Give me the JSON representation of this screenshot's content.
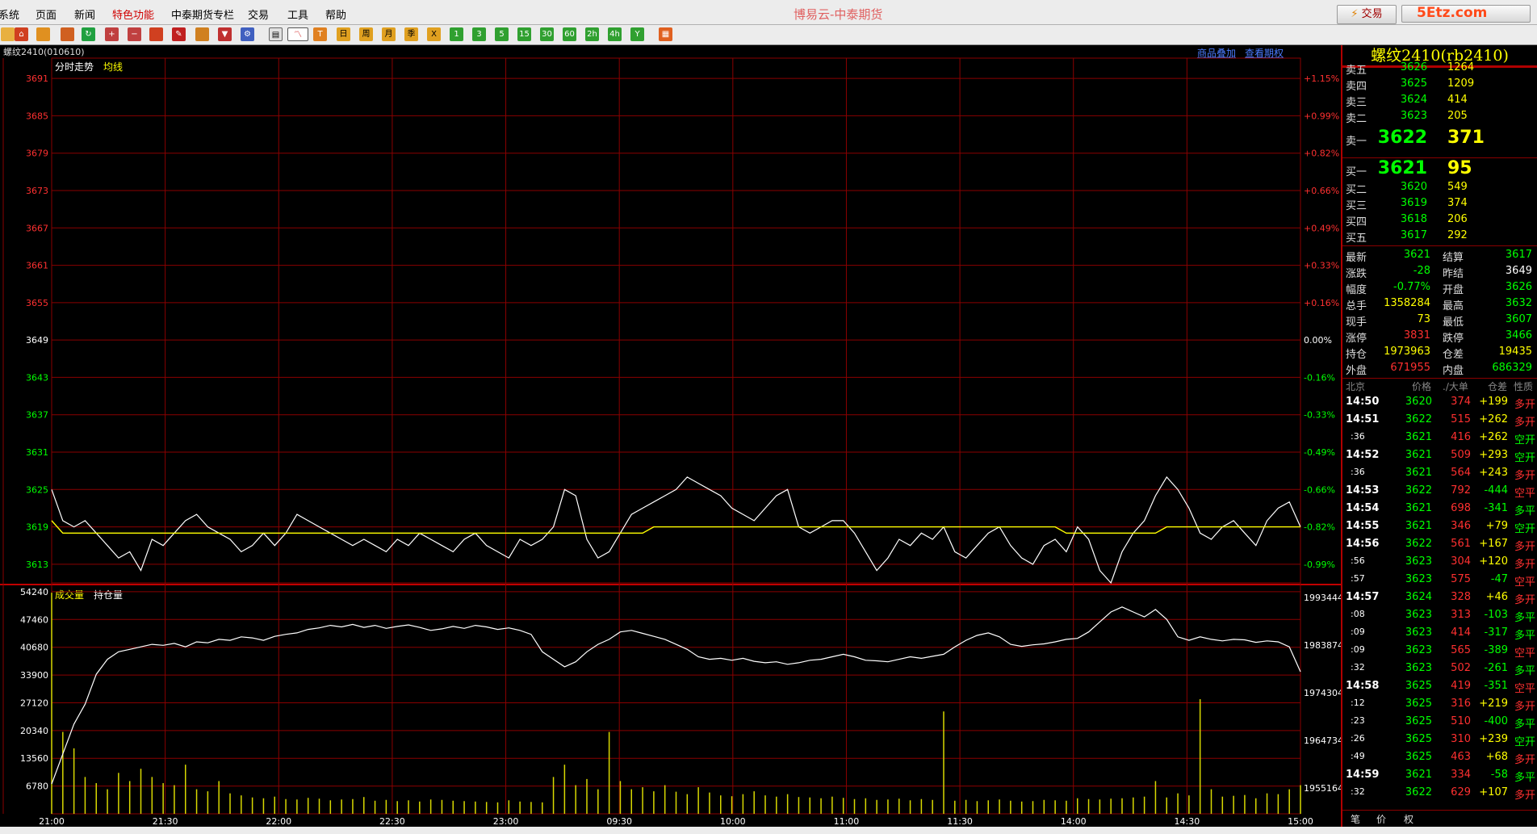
{
  "menu": [
    "系统",
    "页面",
    "新闻",
    "特色功能",
    "中泰期货专栏",
    "交易",
    "工具",
    "帮助"
  ],
  "app_title": "博易云-中泰期货",
  "trade_button": "交易",
  "watermark": "5Etz.com",
  "chart": {
    "symbol_header": "螺纹2410(010610)",
    "link_overlay": "商品叠加",
    "link_options": "查看期权",
    "legend_price": "分时走势",
    "legend_avg": "均线",
    "legend_volume": "成交量",
    "legend_oi": "持仓量",
    "price_axis": [
      "3691",
      "3685",
      "3679",
      "3673",
      "3667",
      "3661",
      "3655",
      "3649",
      "3643",
      "3637",
      "3631",
      "3625",
      "3619",
      "3613"
    ],
    "pct_axis": [
      "+1.15%",
      "+0.99%",
      "+0.82%",
      "+0.66%",
      "+0.49%",
      "+0.33%",
      "+0.16%",
      "0.00%",
      "-0.16%",
      "-0.33%",
      "-0.49%",
      "-0.66%",
      "-0.82%",
      "-0.99%"
    ],
    "volume_axis": [
      "54240",
      "47460",
      "40680",
      "33900",
      "27120",
      "20340",
      "13560",
      "6780"
    ],
    "oi_axis": [
      "1993444",
      "1983874",
      "1974304",
      "1964734",
      "1955164"
    ],
    "time_axis": [
      "21:00",
      "21:30",
      "22:00",
      "22:30",
      "23:00",
      "09:30",
      "10:00",
      "11:00",
      "11:30",
      "14:00",
      "14:30",
      "15:00"
    ]
  },
  "chart_data": {
    "type": "line",
    "title": "螺纹2410 分时走势",
    "xlabel": "",
    "ylabel": "",
    "ylim": [
      3610,
      3694
    ],
    "reference_price": 3649,
    "series": [
      {
        "name": "分时走势",
        "values": [
          3625,
          3620,
          3619,
          3620,
          3618,
          3616,
          3614,
          3615,
          3612,
          3617,
          3616,
          3618,
          3620,
          3621,
          3619,
          3618,
          3617,
          3615,
          3616,
          3618,
          3616,
          3618,
          3621,
          3620,
          3619,
          3618,
          3617,
          3616,
          3617,
          3616,
          3615,
          3617,
          3616,
          3618,
          3617,
          3616,
          3615,
          3617,
          3618,
          3616,
          3615,
          3614,
          3617,
          3616,
          3617,
          3619,
          3625,
          3624,
          3617,
          3614,
          3615,
          3618,
          3621,
          3622,
          3623,
          3624,
          3625,
          3627,
          3626,
          3625,
          3624,
          3622,
          3621,
          3620,
          3622,
          3624,
          3625,
          3619,
          3618,
          3619,
          3620,
          3620,
          3618,
          3615,
          3612,
          3614,
          3617,
          3616,
          3618,
          3617,
          3619,
          3615,
          3614,
          3616,
          3618,
          3619,
          3616,
          3614,
          3613,
          3616,
          3617,
          3615,
          3619,
          3617,
          3612,
          3610,
          3615,
          3618,
          3620,
          3624,
          3627,
          3625,
          3622,
          3618,
          3617,
          3619,
          3620,
          3618,
          3616,
          3620,
          3622,
          3623,
          3619
        ]
      },
      {
        "name": "均线",
        "values": [
          3620,
          3618,
          3618,
          3618,
          3618,
          3618,
          3618,
          3618,
          3618,
          3618,
          3618,
          3618,
          3618,
          3618,
          3618,
          3618,
          3618,
          3618,
          3618,
          3618,
          3618,
          3618,
          3618,
          3618,
          3618,
          3618,
          3618,
          3618,
          3618,
          3618,
          3618,
          3618,
          3618,
          3618,
          3618,
          3618,
          3618,
          3618,
          3618,
          3618,
          3618,
          3618,
          3618,
          3618,
          3618,
          3618,
          3618,
          3618,
          3618,
          3618,
          3618,
          3618,
          3618,
          3618,
          3619,
          3619,
          3619,
          3619,
          3619,
          3619,
          3619,
          3619,
          3619,
          3619,
          3619,
          3619,
          3619,
          3619,
          3619,
          3619,
          3619,
          3619,
          3619,
          3619,
          3619,
          3619,
          3619,
          3619,
          3619,
          3619,
          3619,
          3619,
          3619,
          3619,
          3619,
          3619,
          3619,
          3619,
          3619,
          3619,
          3619,
          3618,
          3618,
          3618,
          3618,
          3618,
          3618,
          3618,
          3618,
          3618,
          3619,
          3619,
          3619,
          3619,
          3619,
          3619,
          3619,
          3619,
          3619,
          3619,
          3619,
          3619,
          3619
        ]
      }
    ],
    "volume_ylim": [
      0,
      56000
    ],
    "volume": [
      54000,
      20000,
      16000,
      9000,
      7500,
      6000,
      10000,
      8000,
      11000,
      9000,
      7500,
      7000,
      12000,
      6000,
      5500,
      8000,
      5000,
      4500,
      4000,
      3800,
      4200,
      3600,
      3500,
      3900,
      3700,
      3300,
      3500,
      3600,
      4100,
      3200,
      3400,
      3100,
      3300,
      3000,
      3500,
      3400,
      3200,
      3100,
      3000,
      2900,
      2800,
      3300,
      3000,
      2900,
      2800,
      9000,
      12000,
      7000,
      8500,
      6000,
      20000,
      8000,
      6000,
      6500,
      5500,
      7000,
      5400,
      4800,
      6500,
      5200,
      4500,
      4300,
      4800,
      5500,
      4500,
      4200,
      4800,
      4100,
      4000,
      3800,
      4200,
      3900,
      3600,
      3800,
      3400,
      3500,
      3700,
      3300,
      3600,
      3400,
      25000,
      3200,
      3400,
      3100,
      3300,
      3500,
      3200,
      3000,
      3100,
      3400,
      3300,
      3200,
      3800,
      3600,
      3500,
      3700,
      3800,
      4000,
      4200,
      8000,
      4000,
      5000,
      4500,
      28000,
      6000,
      4200,
      4400,
      4600,
      3800,
      5000,
      4800,
      6000,
      7000
    ],
    "oi_ylim": [
      1950000,
      1996000
    ],
    "open_interest": [
      1956000,
      1962000,
      1968000,
      1972000,
      1978000,
      1981000,
      1982500,
      1983000,
      1983500,
      1984000,
      1983800,
      1984200,
      1983500,
      1984500,
      1984300,
      1985000,
      1984800,
      1985500,
      1985300,
      1984800,
      1985600,
      1986000,
      1986300,
      1987000,
      1987300,
      1987800,
      1987500,
      1988000,
      1987400,
      1987800,
      1987200,
      1987600,
      1987900,
      1987400,
      1986800,
      1987100,
      1987600,
      1987200,
      1987800,
      1987500,
      1987000,
      1987300,
      1986800,
      1986000,
      1982500,
      1981000,
      1979500,
      1980500,
      1982500,
      1984000,
      1985000,
      1986500,
      1986800,
      1986200,
      1985600,
      1985000,
      1984000,
      1983000,
      1981500,
      1981000,
      1981200,
      1980800,
      1981200,
      1980600,
      1980300,
      1980500,
      1980000,
      1980300,
      1980800,
      1981000,
      1981500,
      1982000,
      1981500,
      1980800,
      1980700,
      1980500,
      1981000,
      1981500,
      1981200,
      1981600,
      1982000,
      1983500,
      1984800,
      1985800,
      1986300,
      1985500,
      1984000,
      1983600,
      1983900,
      1984100,
      1984500,
      1985000,
      1985200,
      1986500,
      1988500,
      1990500,
      1991500,
      1990500,
      1989500,
      1991000,
      1989000,
      1985500,
      1984800,
      1985500,
      1985000,
      1984700,
      1985000,
      1984900,
      1984400,
      1984700,
      1984500,
      1983500,
      1978500
    ]
  },
  "panel": {
    "title": "螺纹2410(rb2410)",
    "asks": [
      {
        "label": "卖五",
        "price": "3626",
        "vol": "1264"
      },
      {
        "label": "卖四",
        "price": "3625",
        "vol": "1209"
      },
      {
        "label": "卖三",
        "price": "3624",
        "vol": "414"
      },
      {
        "label": "卖二",
        "price": "3623",
        "vol": "205"
      },
      {
        "label": "卖一",
        "price": "3622",
        "vol": "371"
      }
    ],
    "bids": [
      {
        "label": "买一",
        "price": "3621",
        "vol": "95"
      },
      {
        "label": "买二",
        "price": "3620",
        "vol": "549"
      },
      {
        "label": "买三",
        "price": "3619",
        "vol": "374"
      },
      {
        "label": "买四",
        "price": "3618",
        "vol": "206"
      },
      {
        "label": "买五",
        "price": "3617",
        "vol": "292"
      }
    ],
    "stats": [
      {
        "l1": "最新",
        "v1": "3621",
        "c1": "#00ff00",
        "l2": "结算",
        "v2": "3617",
        "c2": "#00ff00"
      },
      {
        "l1": "涨跌",
        "v1": "-28",
        "c1": "#00ff00",
        "l2": "昨结",
        "v2": "3649",
        "c2": "#ffffff"
      },
      {
        "l1": "幅度",
        "v1": "-0.77%",
        "c1": "#00ff00",
        "l2": "开盘",
        "v2": "3626",
        "c2": "#00ff00"
      },
      {
        "l1": "总手",
        "v1": "1358284",
        "c1": "#ffff00",
        "l2": "最高",
        "v2": "3632",
        "c2": "#00ff00"
      },
      {
        "l1": "现手",
        "v1": "73",
        "c1": "#ffff00",
        "l2": "最低",
        "v2": "3607",
        "c2": "#00ff00"
      },
      {
        "l1": "涨停",
        "v1": "3831",
        "c1": "#ff3030",
        "l2": "跌停",
        "v2": "3466",
        "c2": "#00ff00"
      },
      {
        "l1": "持仓",
        "v1": "1973963",
        "c1": "#ffff00",
        "l2": "仓差",
        "v2": "19435",
        "c2": "#ffff00"
      },
      {
        "l1": "外盘",
        "v1": "671955",
        "c1": "#ff3030",
        "l2": "内盘",
        "v2": "686329",
        "c2": "#00ff00"
      }
    ],
    "ticks_header": [
      "北京",
      "价格",
      "./大单",
      "仓差",
      "性质"
    ],
    "ticks": [
      {
        "t": "14:50",
        "p": "3620",
        "v": "374",
        "d": "+199",
        "n": "多开",
        "nc": "#ff3030"
      },
      {
        "t": "14:51",
        "p": "3622",
        "v": "515",
        "d": "+262",
        "n": "多开",
        "nc": "#ff3030"
      },
      {
        "t": ":36",
        "p": "3621",
        "v": "416",
        "d": "+262",
        "n": "空开",
        "nc": "#00ff00"
      },
      {
        "t": "14:52",
        "p": "3621",
        "v": "509",
        "d": "+293",
        "n": "空开",
        "nc": "#00ff00"
      },
      {
        "t": ":36",
        "p": "3621",
        "v": "564",
        "d": "+243",
        "n": "多开",
        "nc": "#ff3030"
      },
      {
        "t": "14:53",
        "p": "3622",
        "v": "792",
        "d": "-444",
        "n": "空平",
        "nc": "#ff3030"
      },
      {
        "t": "14:54",
        "p": "3621",
        "v": "698",
        "d": "-341",
        "n": "多平",
        "nc": "#00ff00"
      },
      {
        "t": "14:55",
        "p": "3621",
        "v": "346",
        "d": "+79",
        "n": "空开",
        "nc": "#00ff00"
      },
      {
        "t": "14:56",
        "p": "3622",
        "v": "561",
        "d": "+167",
        "n": "多开",
        "nc": "#ff3030"
      },
      {
        "t": ":56",
        "p": "3623",
        "v": "304",
        "d": "+120",
        "n": "多开",
        "nc": "#ff3030"
      },
      {
        "t": ":57",
        "p": "3623",
        "v": "575",
        "d": "-47",
        "n": "空平",
        "nc": "#ff3030"
      },
      {
        "t": "14:57",
        "p": "3624",
        "v": "328",
        "d": "+46",
        "n": "多开",
        "nc": "#ff3030"
      },
      {
        "t": ":08",
        "p": "3623",
        "v": "313",
        "d": "-103",
        "n": "多平",
        "nc": "#00ff00"
      },
      {
        "t": ":09",
        "p": "3623",
        "v": "414",
        "d": "-317",
        "n": "多平",
        "nc": "#00ff00"
      },
      {
        "t": ":09",
        "p": "3623",
        "v": "565",
        "d": "-389",
        "n": "空平",
        "nc": "#ff3030"
      },
      {
        "t": ":32",
        "p": "3623",
        "v": "502",
        "d": "-261",
        "n": "多平",
        "nc": "#00ff00"
      },
      {
        "t": "14:58",
        "p": "3625",
        "v": "419",
        "d": "-351",
        "n": "空平",
        "nc": "#ff3030"
      },
      {
        "t": ":12",
        "p": "3625",
        "v": "316",
        "d": "+219",
        "n": "多开",
        "nc": "#ff3030"
      },
      {
        "t": ":23",
        "p": "3625",
        "v": "510",
        "d": "-400",
        "n": "多平",
        "nc": "#00ff00"
      },
      {
        "t": ":26",
        "p": "3625",
        "v": "310",
        "d": "+239",
        "n": "空开",
        "nc": "#00ff00"
      },
      {
        "t": ":49",
        "p": "3625",
        "v": "463",
        "d": "+68",
        "n": "多开",
        "nc": "#ff3030"
      },
      {
        "t": "14:59",
        "p": "3621",
        "v": "334",
        "d": "-58",
        "n": "多平",
        "nc": "#00ff00"
      },
      {
        "t": ":32",
        "p": "3622",
        "v": "629",
        "d": "+107",
        "n": "多开",
        "nc": "#ff3030"
      }
    ],
    "bottom_tabs": [
      "笔",
      "价",
      "权"
    ]
  },
  "colors": {
    "up": "#ff3030",
    "down": "#00ff00",
    "grid": "#8a0000",
    "line": "#ffffff",
    "avg": "#ffff00",
    "volume": "#d8d800"
  }
}
